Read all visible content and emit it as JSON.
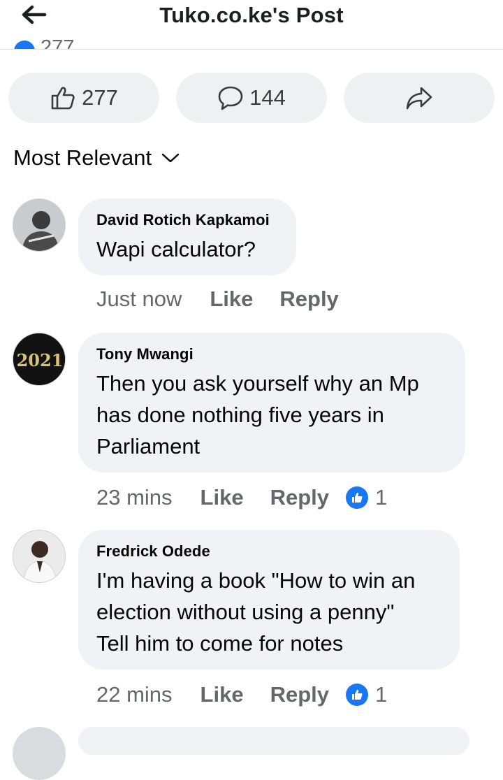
{
  "header": {
    "title": "Tuko.co.ke's Post",
    "back_icon": "arrow-left-icon"
  },
  "reactions_peek": {
    "count": "277"
  },
  "actions": {
    "like_count": "277",
    "comment_count": "144",
    "share_icon": "share-icon"
  },
  "sort": {
    "label": "Most Relevant"
  },
  "colors": {
    "accent": "#1877f2",
    "bubble": "#f0f2f5",
    "meta": "#65676b"
  },
  "comments": [
    {
      "author": "David Rotich Kapkamoi",
      "text": "Wapi calculator?",
      "time": "Just now",
      "like": "Like",
      "reply": "Reply",
      "reaction_count": ""
    },
    {
      "author": "Tony Mwangi",
      "text": "Then you ask yourself why an Mp\nhas done nothing five years in\nParliament",
      "time": "23 mins",
      "like": "Like",
      "reply": "Reply",
      "reaction_count": "1",
      "avatar_text": "2021"
    },
    {
      "author": "Fredrick Odede",
      "text": "I'm having a book \"How to win an\nelection without using a penny\"\nTell him to come for notes",
      "time": "22 mins",
      "like": "Like",
      "reply": "Reply",
      "reaction_count": "1"
    }
  ]
}
